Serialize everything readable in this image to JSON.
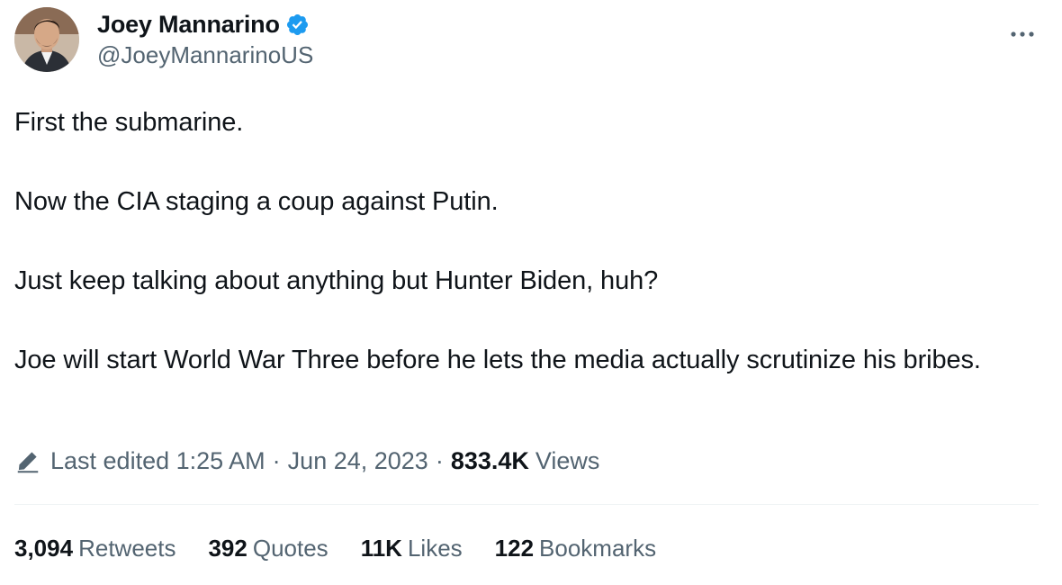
{
  "author": {
    "display_name": "Joey Mannarino",
    "handle": "@JoeyMannarinoUS",
    "verified_color": "#1d9bf0"
  },
  "tweet": {
    "paragraphs": [
      "First the submarine.",
      "Now the CIA staging a coup against Putin.",
      "Just keep talking about anything but Hunter Biden, huh?",
      "Joe will start World War Three before he lets the media actually scrutinize his bribes."
    ]
  },
  "meta": {
    "edited_label": "Last edited 1:25 AM",
    "date": "Jun 24, 2023",
    "views_count": "833.4K",
    "views_label": "Views",
    "separator": "·"
  },
  "stats": [
    {
      "count": "3,094",
      "label": "Retweets"
    },
    {
      "count": "392",
      "label": "Quotes"
    },
    {
      "count": "11K",
      "label": "Likes"
    },
    {
      "count": "122",
      "label": "Bookmarks"
    }
  ],
  "icons": {
    "more": "more-options-icon",
    "verified": "verified-badge-icon",
    "edit": "pencil-edit-icon"
  },
  "colors": {
    "text_primary": "#0f1419",
    "text_secondary": "#536471",
    "accent": "#1d9bf0",
    "divider": "#eff3f4"
  }
}
